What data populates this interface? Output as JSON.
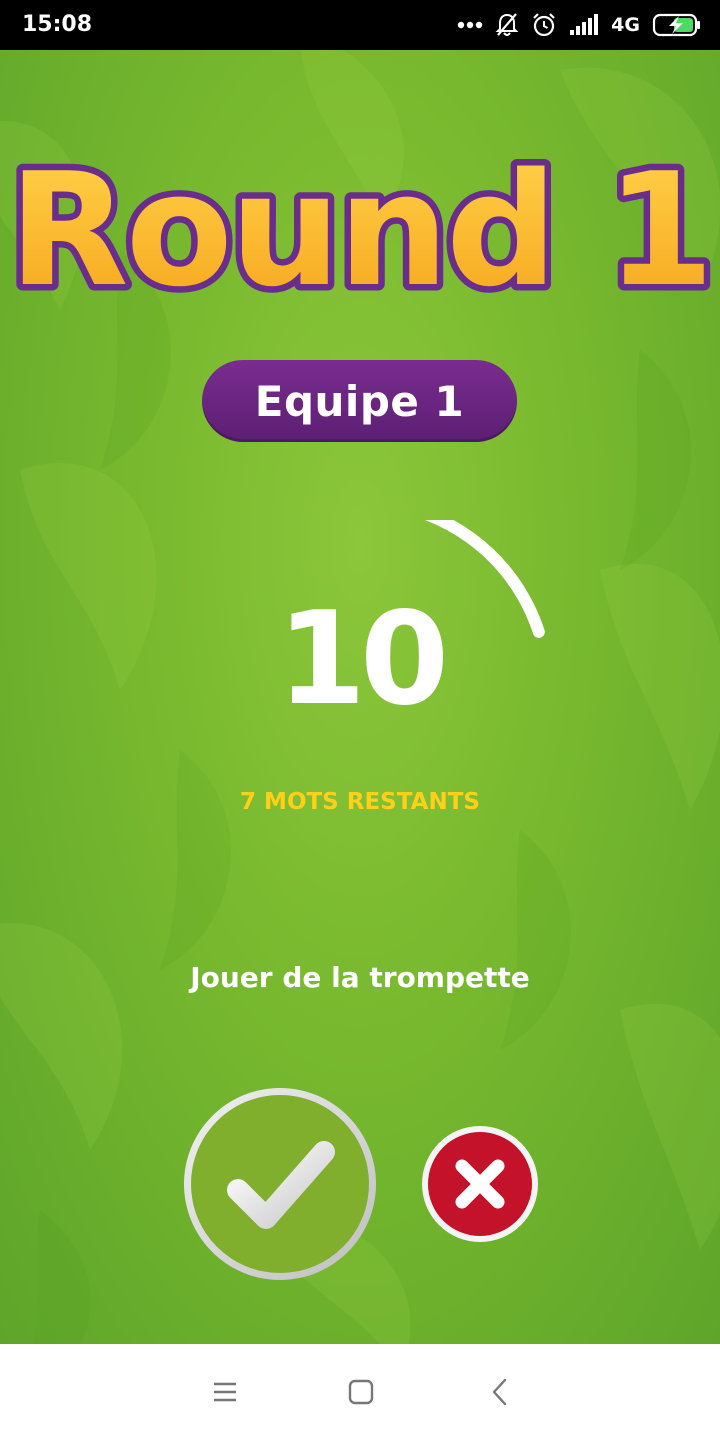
{
  "status_bar": {
    "time": "15:08",
    "network": "4G",
    "icons": [
      "more-dots-icon",
      "notifications-off-icon",
      "alarm-icon",
      "signal-icon",
      "battery-charging-icon"
    ]
  },
  "game": {
    "title": "Round 1",
    "team": "Equipe 1",
    "countdown": "10",
    "words_remaining": "7 MOTS RESTANTS",
    "current_word": "Jouer de la trompette",
    "timer_remaining_fraction": 0.2,
    "colors": {
      "background": "#77b82e",
      "title_fill": "#ffb825",
      "title_outline": "#6b2d8c",
      "pill": "#6b2484",
      "accent_yellow": "#ffcf1a",
      "correct_button": "#78a82a",
      "wrong_button": "#c3122a"
    }
  },
  "buttons": {
    "correct_icon": "check-icon",
    "wrong_icon": "close-icon"
  },
  "nav_bar": {
    "items": [
      "menu-icon",
      "home-icon",
      "back-icon"
    ]
  }
}
